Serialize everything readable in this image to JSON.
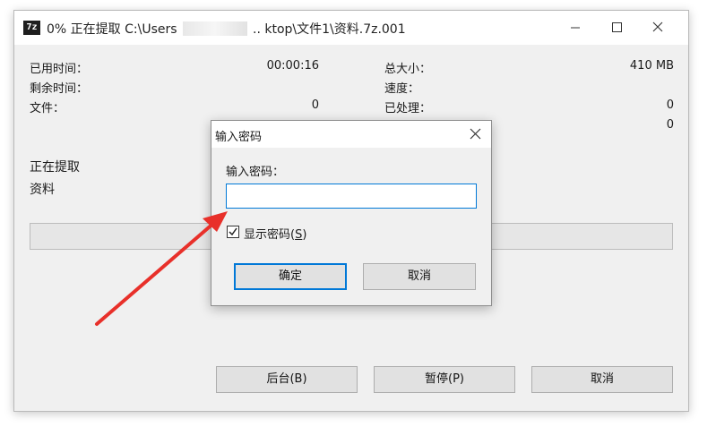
{
  "window": {
    "app_icon": "7z",
    "title_prefix": "0% 正在提取 C:\\Users",
    "title_suffix": ".. ktop\\文件1\\资料.7z.001",
    "controls": {
      "minimize": "minimize-icon",
      "maximize": "maximize-icon",
      "close": "close-icon"
    }
  },
  "stats": {
    "elapsed_label": "已用时间：",
    "elapsed_value": "00:00:16",
    "remaining_label": "剩余时间：",
    "files_label": "文件：",
    "files_value": "0",
    "total_label": "总大小：",
    "total_value": "410 MB",
    "speed_label": "速度：",
    "processed_label": "已处理：",
    "processed_value": "0",
    "fourth_value": "0"
  },
  "status": {
    "line1": "正在提取",
    "line2": "资料"
  },
  "progress": {
    "percent": 0
  },
  "buttons": {
    "background": "后台(B)",
    "pause": "暂停(P)",
    "cancel": "取消"
  },
  "dialog": {
    "title": "输入密码",
    "label": "输入密码：",
    "password_value": "",
    "show_password_prefix": "显示密码(",
    "show_password_key": "S",
    "show_password_suffix": ")",
    "show_password_checked": true,
    "ok": "确定",
    "cancel": "取消"
  },
  "colors": {
    "accent": "#0078d7",
    "arrow": "#e8302a"
  }
}
